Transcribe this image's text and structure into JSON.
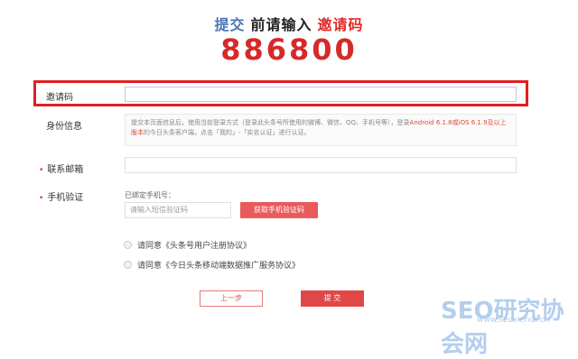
{
  "header": {
    "submit_word": "提交",
    "middle_text": "前请输入",
    "code_word": "邀请码",
    "invite_code": "886800"
  },
  "form": {
    "invite": {
      "label": "邀请码",
      "value": ""
    },
    "identity": {
      "label": "身份信息",
      "text_part1": "提交本页面信息后，使用当前登录方式（登录此头条号所使用的微博、微信、QQ、手机号等），登录",
      "text_highlight1": "Android 6.1.8或iOS 6.1.9及以上版本",
      "text_part2": "的今日头条客户端，点击「我的」-「实名认证」进行认证。"
    },
    "email": {
      "required_mark": "•",
      "label": "联系邮箱",
      "value": ""
    },
    "phone": {
      "required_mark": "•",
      "label": "手机验证",
      "bound_label": "已绑定手机号：",
      "sms_placeholder": "请输入短信验证码",
      "sms_button": "获取手机验证码"
    },
    "agreements": [
      "请同意《头条号用户注册协议》",
      "请同意《今日头条移动端数据推广服务协议》"
    ]
  },
  "actions": {
    "prev": "上一步",
    "submit": "提 交"
  },
  "watermark": {
    "brand": "SEO研究协会网",
    "url": "www.seoxiehui.cn"
  },
  "colors": {
    "accent_red": "#e04848",
    "headline_blue": "#4b76b8",
    "code_red": "#d62a2a"
  }
}
